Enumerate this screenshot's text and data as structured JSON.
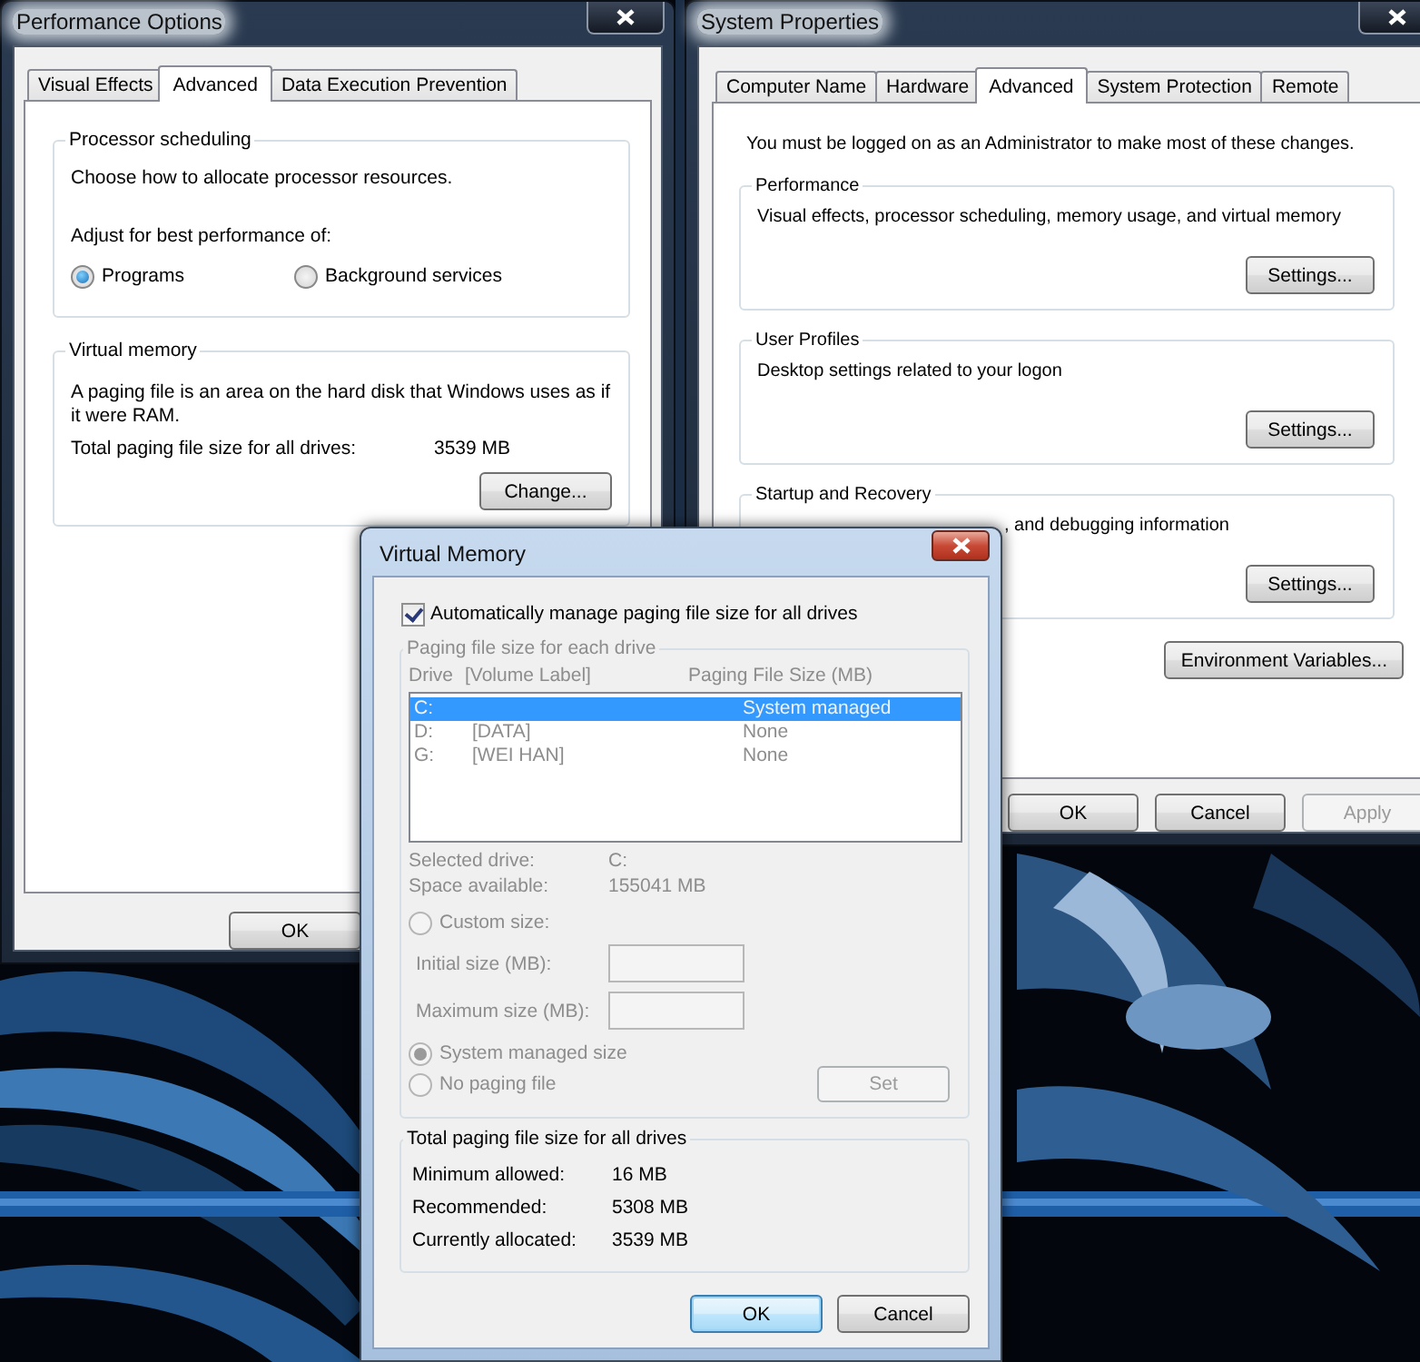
{
  "performance_options": {
    "title": "Performance Options",
    "tabs": [
      {
        "label": "Visual Effects",
        "selected": false
      },
      {
        "label": "Advanced",
        "selected": true
      },
      {
        "label": "Data Execution Prevention",
        "selected": false
      }
    ],
    "processor_scheduling": {
      "title": "Processor scheduling",
      "description": "Choose how to allocate processor resources.",
      "prompt": "Adjust for best performance of:",
      "options": [
        {
          "label": "Programs",
          "selected": true
        },
        {
          "label": "Background services",
          "selected": false
        }
      ]
    },
    "virtual_memory": {
      "title": "Virtual memory",
      "description": "A paging file is an area on the hard disk that Windows uses as if it were RAM.",
      "total_label": "Total paging file size for all drives:",
      "total_value": "3539 MB",
      "button": "Change..."
    },
    "buttons": [
      "OK"
    ]
  },
  "system_properties": {
    "title": "System Properties",
    "tabs": [
      {
        "label": "Computer Name",
        "selected": false
      },
      {
        "label": "Hardware",
        "selected": false
      },
      {
        "label": "Advanced",
        "selected": true
      },
      {
        "label": "System Protection",
        "selected": false
      },
      {
        "label": "Remote",
        "selected": false
      }
    ],
    "notice": "You must be logged on as an Administrator to make most of these changes.",
    "groups": [
      {
        "title": "Performance",
        "description": "Visual effects, processor scheduling, memory usage, and virtual memory",
        "button": "Settings..."
      },
      {
        "title": "User Profiles",
        "description": "Desktop settings related to your logon",
        "button": "Settings..."
      },
      {
        "title": "Startup and Recovery",
        "description": ", and debugging information",
        "button": "Settings..."
      }
    ],
    "environment_button": "Environment Variables...",
    "buttons": [
      {
        "label": "OK",
        "disabled": false
      },
      {
        "label": "Cancel",
        "disabled": false
      },
      {
        "label": "Apply",
        "disabled": true
      }
    ]
  },
  "virtual_memory_dialog": {
    "title": "Virtual Memory",
    "auto_manage": {
      "label": "Automatically manage paging file size for all drives",
      "checked": true
    },
    "drives": {
      "title": "Paging file size for each drive",
      "disabled": true,
      "columns": [
        "Drive",
        "[Volume Label]",
        "Paging File Size (MB)"
      ],
      "rows": [
        {
          "drive": "C:",
          "size": "System managed",
          "selected": true
        },
        {
          "drive": "D:",
          "label": "[DATA]",
          "size": "None",
          "selected": false
        },
        {
          "drive": "G:",
          "label": "[WEI HAN]",
          "size": "None",
          "selected": false
        }
      ],
      "details": [
        {
          "label": "Selected drive:",
          "value": "C:"
        },
        {
          "label": "Space available:",
          "value": "155041 MB"
        }
      ],
      "size_options": [
        {
          "kind": "radio",
          "label": "Custom size:",
          "selected": false
        },
        {
          "kind": "field",
          "label": "Initial size (MB):"
        },
        {
          "kind": "field",
          "label": "Maximum size (MB):"
        },
        {
          "kind": "radio",
          "label": "System managed size",
          "selected": true
        },
        {
          "kind": "radio",
          "label": "No paging file",
          "selected": false
        }
      ],
      "set_button": "Set"
    },
    "totals": {
      "title": "Total paging file size for all drives",
      "rows": [
        {
          "label": "Minimum allowed:",
          "value": "16 MB"
        },
        {
          "label": "Recommended:",
          "value": "5308 MB"
        },
        {
          "label": "Currently allocated:",
          "value": "3539 MB"
        }
      ]
    },
    "buttons": [
      {
        "label": "OK",
        "default": true
      },
      {
        "label": "Cancel",
        "default": false
      }
    ]
  }
}
